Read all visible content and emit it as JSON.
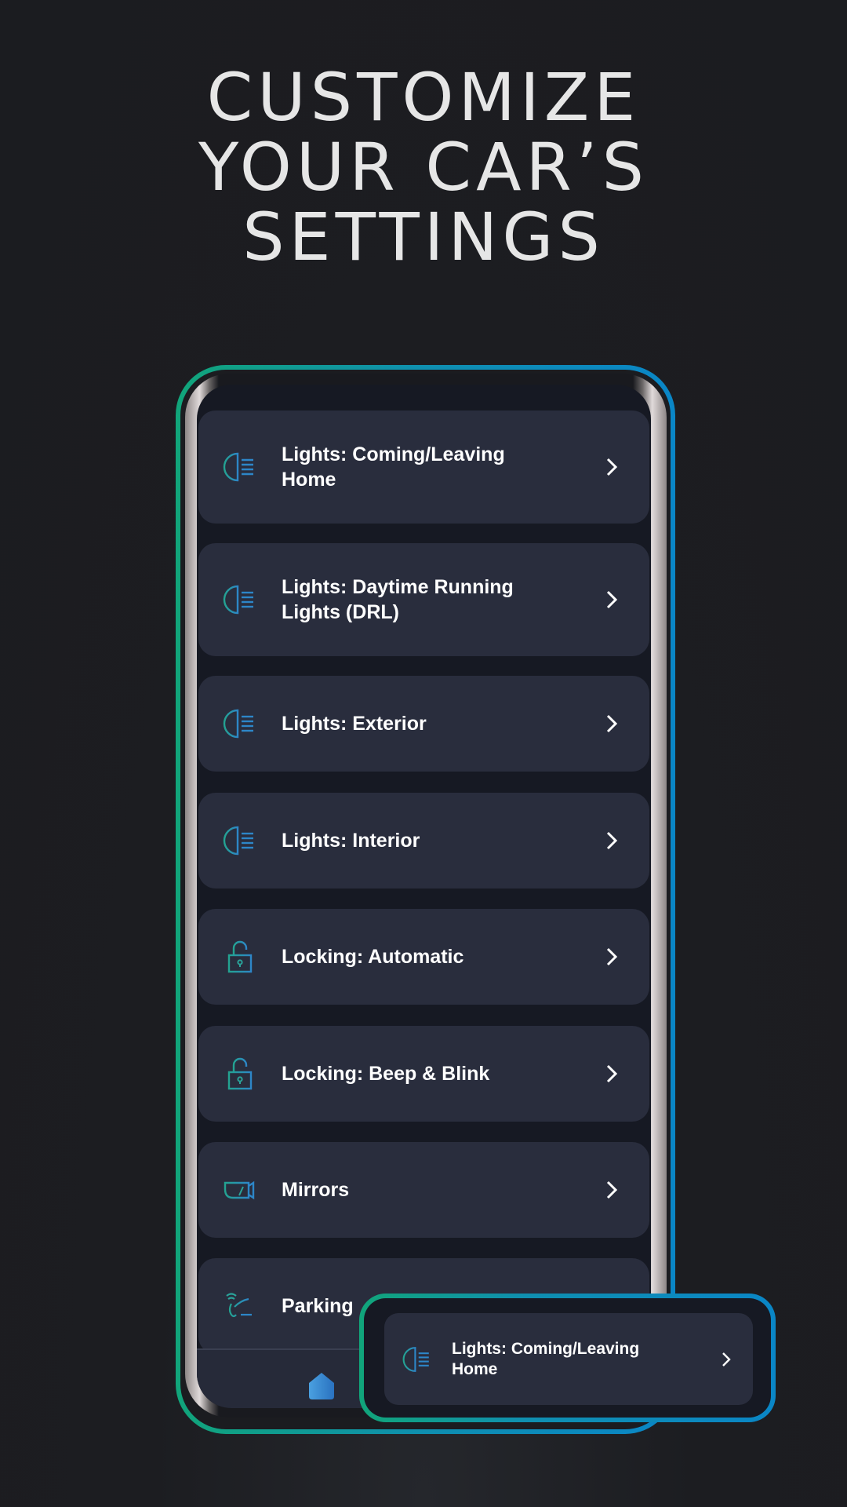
{
  "headline": [
    "CUSTOMIZE",
    "YOUR CAR’S",
    "SETTINGS"
  ],
  "colors": {
    "accent_green": "#11a57a",
    "accent_blue": "#0a86c6",
    "card": "#292d3d",
    "icon_teal": "#2aa39a"
  },
  "settings_list": [
    {
      "label": "Lights: Coming/Leaving Home",
      "icon": "headlight-icon"
    },
    {
      "label": "Lights: Daytime Running Lights (DRL)",
      "icon": "headlight-icon"
    },
    {
      "label": "Lights: Exterior",
      "icon": "headlight-icon"
    },
    {
      "label": "Lights: Interior",
      "icon": "headlight-icon"
    },
    {
      "label": "Locking: Automatic",
      "icon": "padlock-icon"
    },
    {
      "label": "Locking: Beep & Blink",
      "icon": "padlock-icon"
    },
    {
      "label": "Mirrors",
      "icon": "mirror-icon"
    },
    {
      "label": "Parking",
      "icon": "parking-sensor-icon"
    }
  ],
  "bottom_nav": {
    "active": "home-icon"
  },
  "callout": {
    "label": "Lights: Coming/Leaving Home",
    "icon": "headlight-icon"
  }
}
